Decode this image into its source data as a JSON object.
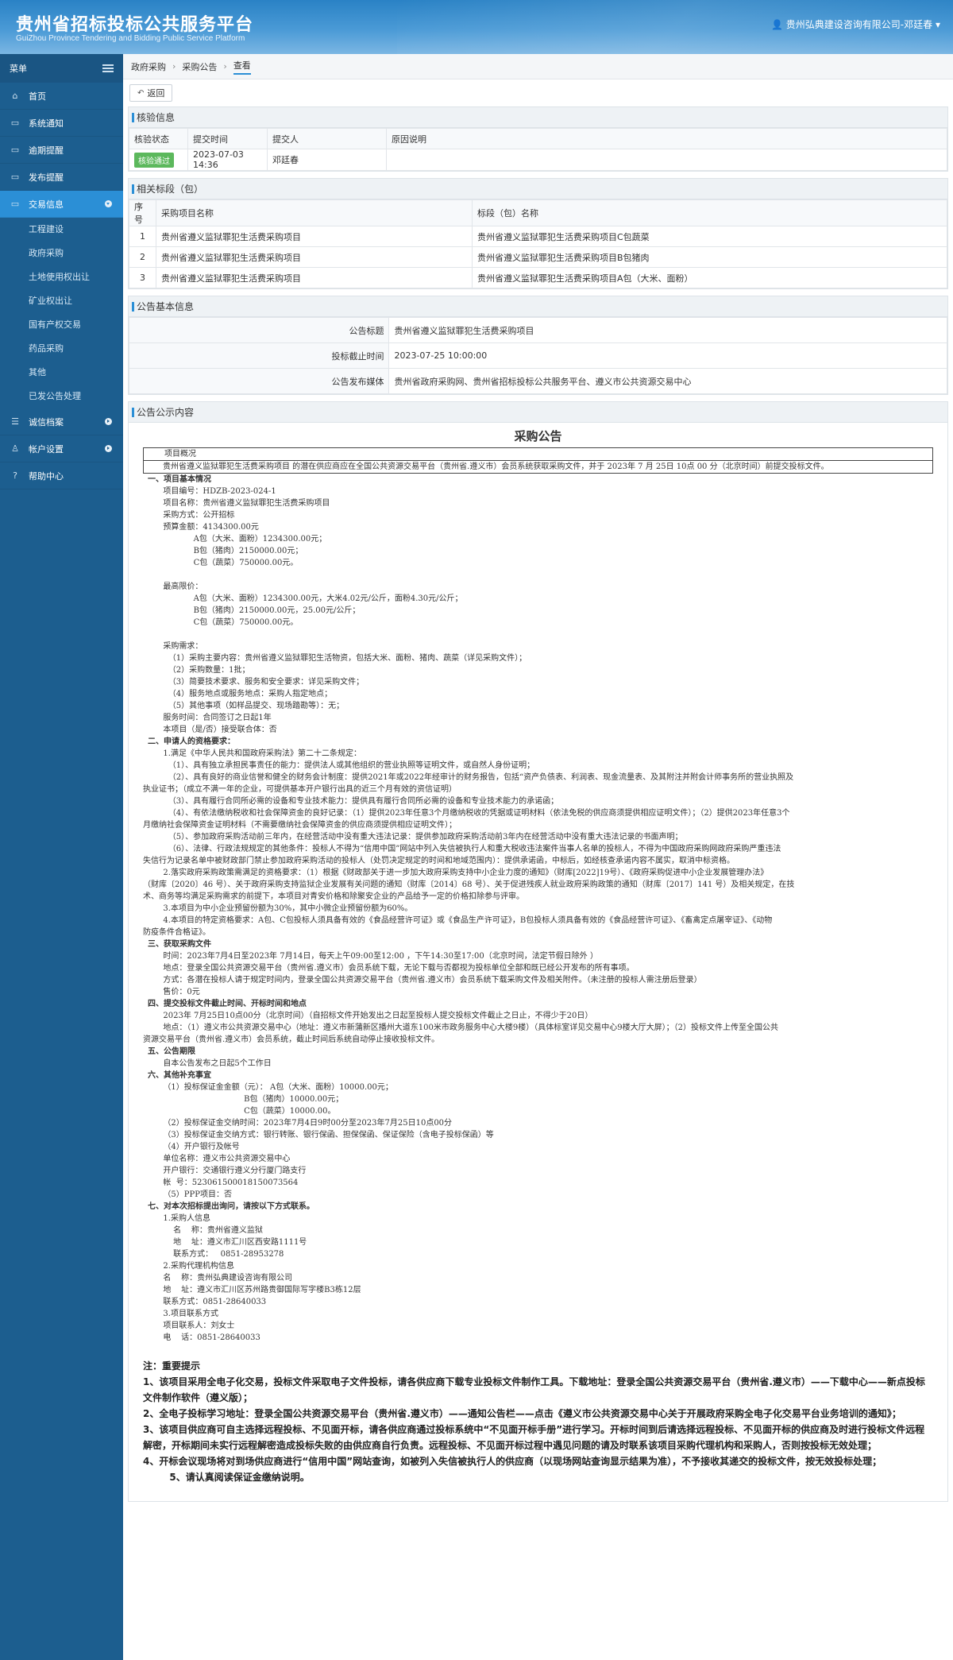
{
  "header": {
    "title": "贵州省招标投标公共服务平台",
    "subtitle": "GuiZhou Province Tendering and Bidding Public Service Platform",
    "user": "贵州弘典建设咨询有限公司-邓廷春"
  },
  "sidebar": {
    "head": "菜单",
    "items": [
      {
        "label": "首页",
        "icon": "home-icon",
        "glyph": "⌂"
      },
      {
        "label": "系统通知",
        "icon": "monitor-icon",
        "glyph": "▭"
      },
      {
        "label": "逾期提醒",
        "icon": "monitor-icon",
        "glyph": "▭"
      },
      {
        "label": "发布提醒",
        "icon": "monitor-icon",
        "glyph": "▭"
      },
      {
        "label": "交易信息",
        "icon": "monitor-icon",
        "glyph": "▭"
      },
      {
        "label": "诚信档案",
        "icon": "list-icon",
        "glyph": "☰"
      },
      {
        "label": "帐户设置",
        "icon": "user-icon",
        "glyph": "♙"
      },
      {
        "label": "帮助中心",
        "icon": "help-icon",
        "glyph": "?"
      }
    ],
    "subitems": [
      "工程建设",
      "政府采购",
      "土地使用权出让",
      "矿业权出让",
      "国有产权交易",
      "药品采购",
      "其他",
      "已发公告处理"
    ]
  },
  "breadcrumb": [
    "政府采购",
    "采购公告",
    "查看"
  ],
  "back_label": "返回",
  "verify": {
    "title": "核验信息",
    "headers": [
      "核验状态",
      "提交时间",
      "提交人",
      "原因说明"
    ],
    "status": "核验通过",
    "time": "2023-07-03 14:36",
    "person": "邓廷春",
    "reason": ""
  },
  "sections": {
    "title": "相关标段（包）",
    "headers": [
      "序号",
      "采购项目名称",
      "标段（包）名称"
    ],
    "rows": [
      [
        "1",
        "贵州省遵义监狱罪犯生活费采购项目",
        "贵州省遵义监狱罪犯生活费采购项目C包蔬菜"
      ],
      [
        "2",
        "贵州省遵义监狱罪犯生活费采购项目",
        "贵州省遵义监狱罪犯生活费采购项目B包猪肉"
      ],
      [
        "3",
        "贵州省遵义监狱罪犯生活费采购项目",
        "贵州省遵义监狱罪犯生活费采购项目A包（大米、面粉）"
      ]
    ]
  },
  "basic": {
    "title": "公告基本信息",
    "rows": [
      [
        "公告标题",
        "贵州省遵义监狱罪犯生活费采购项目"
      ],
      [
        "投标截止时间",
        "2023-07-25 10:00:00"
      ],
      [
        "公告发布媒体",
        "贵州省政府采购网、贵州省招标投标公共服务平台、遵义市公共资源交易中心"
      ]
    ]
  },
  "content": {
    "title": "公告公示内容",
    "doc_title": "采购公告",
    "box_r1": "项目概况",
    "box_r2": "贵州省遵义监狱罪犯生活费采购项目 的潜在供应商应在全国公共资源交易平台（贵州省.遵义市）会员系统获取采购文件，并于 2023年 7 月 25日 10点 00 分（北京时间）前提交投标文件。",
    "lines": [
      {
        "t": "一、项目基本情况",
        "h": true
      },
      {
        "t": "        项目编号：HDZB-2023-024-1"
      },
      {
        "t": "        项目名称：贵州省遵义监狱罪犯生活费采购项目"
      },
      {
        "t": "        采购方式：公开招标"
      },
      {
        "t": "        预算金额：4134300.00元"
      },
      {
        "t": "                    A包（大米、面粉）1234300.00元；"
      },
      {
        "t": "                    B包（猪肉）2150000.00元；"
      },
      {
        "t": "                    C包（蔬菜）750000.00元。"
      },
      {
        "t": ""
      },
      {
        "t": "        最高限价："
      },
      {
        "t": "                    A包（大米、面粉）1234300.00元，大米4.02元/公斤，面粉4.30元/公斤；"
      },
      {
        "t": "                    B包（猪肉）2150000.00元，25.00元/公斤；"
      },
      {
        "t": "                    C包（蔬菜）750000.00元。"
      },
      {
        "t": ""
      },
      {
        "t": "        采购需求："
      },
      {
        "t": "          （1）采购主要内容：贵州省遵义监狱罪犯生活物资，包括大米、面粉、猪肉、蔬菜（详见采购文件）；"
      },
      {
        "t": "          （2）采购数量：1批；"
      },
      {
        "t": "          （3）简要技术要求、服务和安全要求：详见采购文件；"
      },
      {
        "t": "          （4）服务地点或服务地点：采购人指定地点；"
      },
      {
        "t": "          （5）其他事项（如样品提交、现场踏勘等）：无；"
      },
      {
        "t": "        服务时间：合同签订之日起1年"
      },
      {
        "t": "        本项目（是/否）接受联合体：否"
      },
      {
        "t": "二、申请人的资格要求：",
        "h": true
      },
      {
        "t": "        1.满足《中华人民共和国政府采购法》第二十二条规定："
      },
      {
        "t": "          （1）、具有独立承担民事责任的能力：提供法人或其他组织的营业执照等证明文件，或自然人身份证明；"
      },
      {
        "t": "          （2）、具有良好的商业信誉和健全的财务会计制度：提供2021年或2022年经审计的财务报告，包括“资产负债表、利润表、现金流量表、及其附注并附会计师事务所的营业执照及"
      },
      {
        "t": "执业证书；（成立不满一年的企业，可提供基本开户银行出具的近三个月有效的资信证明）"
      },
      {
        "t": "          （3）、具有履行合同所必需的设备和专业技术能力：提供具有履行合同所必需的设备和专业技术能力的承诺函；"
      },
      {
        "t": "          （4）、有依法缴纳税收和社会保障资金的良好记录：（1）提供2023年任意3个月缴纳税收的凭据或证明材料（依法免税的供应商须提供相应证明文件）；（2）提供2023年任意3个"
      },
      {
        "t": "月缴纳社会保障资金证明材料（不需要缴纳社会保障资金的供应商须提供相应证明文件）；"
      },
      {
        "t": "          （5）、参加政府采购活动前三年内，在经营活动中没有重大违法记录：提供参加政府采购活动前3年内在经营活动中没有重大违法记录的书面声明；"
      },
      {
        "t": "          （6）、法律、行政法规规定的其他条件：投标人不得为“信用中国”网站中列入失信被执行人和重大税收违法案件当事人名单的投标人，不得为中国政府采购网政府采购严重违法"
      },
      {
        "t": "失信行为记录名单中被财政部门禁止参加政府采购活动的投标人（处罚决定规定的时间和地域范围内）：提供承诺函，中标后，如经核查承诺内容不属实，取消中标资格。"
      },
      {
        "t": "        2.落实政府采购政策需满足的资格要求：（1）根据《财政部关于进一步加大政府采购支持中小企业力度的通知》（财库[2022]19号）、《政府采购促进中小企业发展管理办法》"
      },
      {
        "t": "（财库〔2020〕46 号）、关于政府采购支持监狱企业发展有关问题的通知（财库〔2014〕68 号）、关于促进残疾人就业政府采购政策的通知（财库〔2017〕141 号）及相关规定，在技"
      },
      {
        "t": "术、商务等均满足采购需求的前提下，本项目对青安价格和除聚安企业的产品给予一定的价格扣除参与评审。"
      },
      {
        "t": "        3.本项目为中小企业预留份额为30%，其中小微企业预留份额为60%。"
      },
      {
        "t": "        4.本项目的特定资格要求：A包、C包投标人须具备有效的《食品经营许可证》或《食品生产许可证》，B包投标人须具备有效的《食品经营许可证》、《畜禽定点屠宰证》、《动物"
      },
      {
        "t": "防疫条件合格证》。"
      },
      {
        "t": "三、获取采购文件",
        "h": true
      },
      {
        "t": "        时间：2023年7月4日至2023年 7月14日，每天上午09:00至12:00 ，下午14:30至17:00（北京时间，法定节假日除外 ）"
      },
      {
        "t": "        地点：登录全国公共资源交易平台（贵州省.遵义市）会员系统下载，无论下载与否都视为投标单位全部和既已经公开发布的所有事项。"
      },
      {
        "t": "        方式：各潜在投标人请于规定时间内，登录全国公共资源交易平台（贵州省.遵义市）会员系统下载采购文件及相关附件。（未注册的投标人需注册后登录）"
      },
      {
        "t": "        售价：0元"
      },
      {
        "t": "四、提交投标文件截止时间、开标时间和地点",
        "h": true
      },
      {
        "t": "        2023年 7月25日10点00分（北京时间）（自招标文件开始发出之日起至投标人提交投标文件截止之日止，不得少于20日）"
      },
      {
        "t": "        地点：（1）遵义市公共资源交易中心（地址：遵义市新蒲新区播州大道东100米市政务服务中心大楼9楼）（具体标室详见交易中心9楼大厅大屏）；（2）投标文件上传至全国公共"
      },
      {
        "t": "资源交易平台（贵州省.遵义市）会员系统，截止时间后系统自动停止接收投标文件。"
      },
      {
        "t": "五、公告期限",
        "h": true
      },
      {
        "t": "        自本公告发布之日起5个工作日"
      },
      {
        "t": "六、其他补充事宜",
        "h": true
      },
      {
        "t": "        （1）投标保证金金额（元）： A包（大米、面粉）10000.00元；"
      },
      {
        "t": "                                        B包（猪肉）10000.00元；"
      },
      {
        "t": "                                        C包（蔬菜）10000.00。"
      },
      {
        "t": "        （2）投标保证金交纳时间：2023年7月4日9时00分至2023年7月25日10点00分"
      },
      {
        "t": "        （3）投标保证金交纳方式：银行转账、银行保函、担保保函、保证保险（含电子投标保函）等"
      },
      {
        "t": "        （4）开户银行及帐号"
      },
      {
        "t": "        单位名称：遵义市公共资源交易中心"
      },
      {
        "t": "        开户银行：交通银行遵义分行厦门路支行"
      },
      {
        "t": "        帐  号：523061500018150073564"
      },
      {
        "t": "        （5）PPP项目：否"
      },
      {
        "t": "七、对本次招标提出询问，请按以下方式联系。",
        "h": true
      },
      {
        "t": "        1.采购人信息"
      },
      {
        "t": "            名    称：贵州省遵义监狱"
      },
      {
        "t": "            地    址：遵义市汇川区西安路1111号"
      },
      {
        "t": "            联系方式：   0851-28953278"
      },
      {
        "t": "        2.采购代理机构信息"
      },
      {
        "t": "        名    称：贵州弘典建设咨询有限公司"
      },
      {
        "t": "        地    址：遵义市汇川区苏州路贵御国际写字楼B3栋12层"
      },
      {
        "t": "        联系方式：0851-28640033"
      },
      {
        "t": "        3.项目联系方式"
      },
      {
        "t": "        项目联系人：刘女士"
      },
      {
        "t": "        电    话：0851-28640033"
      }
    ],
    "notes": [
      "注：重要提示",
      "1、该项目采用全电子化交易，投标文件采取电子文件投标，请各供应商下载专业投标文件制作工具。下载地址：登录全国公共资源交易平台（贵州省.遵义市）——下载中心——新点投标文件制作软件（遵义版）；",
      "2、全电子投标学习地址：登录全国公共资源交易平台（贵州省.遵义市）——通知公告栏——点击《遵义市公共资源交易中心关于开展政府采购全电子化交易平台业务培训的通知》；",
      "3、该项目供应商可自主选择远程投标、不见面开标，请各供应商通过投标系统中“不见面开标手册”进行学习。开标时间到后请选择远程投标、不见面开标的供应商及时进行投标文件远程解密，开标期间未实行远程解密造成投标失败的由供应商自行负责。远程投标、不见面开标过程中遇见问题的请及时联系该项目采购代理机构和采购人，否则按投标无效处理；",
      "4、开标会议现场将对到场供应商进行“信用中国”网站查询，如被列入失信被执行人的供应商（以现场网站查询显示结果为准），不予接收其递交的投标文件，按无效投标处理；",
      "        5、请认真阅读保证金缴纳说明。"
    ]
  }
}
